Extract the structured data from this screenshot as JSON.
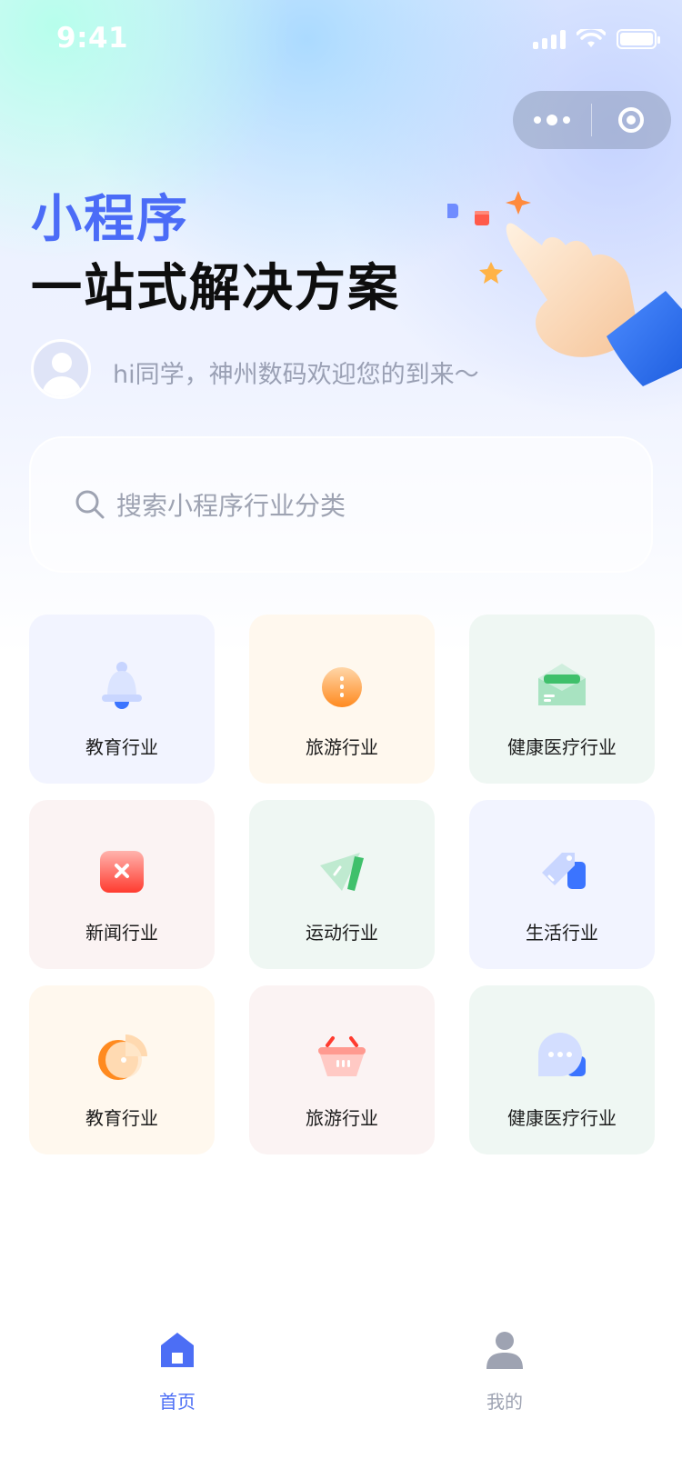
{
  "status_bar": {
    "time": "9:41"
  },
  "hero": {
    "title": "小程序",
    "subtitle": "一站式解决方案",
    "greeting": "hi同学，神州数码欢迎您的到来～"
  },
  "search": {
    "placeholder": "搜索小程序行业分类"
  },
  "categories": [
    {
      "label": "教育行业",
      "icon": "bell-icon",
      "bg": "#f2f4ff"
    },
    {
      "label": "旅游行业",
      "icon": "compass-icon",
      "bg": "#fff8ee"
    },
    {
      "label": "健康医疗行业",
      "icon": "envelope-icon",
      "bg": "#eff7f3"
    },
    {
      "label": "新闻行业",
      "icon": "close-box-icon",
      "bg": "#fbf3f3"
    },
    {
      "label": "运动行业",
      "icon": "paper-plane-icon",
      "bg": "#eff7f3"
    },
    {
      "label": "生活行业",
      "icon": "tag-icon",
      "bg": "#f2f4ff"
    },
    {
      "label": "教育行业",
      "icon": "pie-chart-icon",
      "bg": "#fff8ee"
    },
    {
      "label": "旅游行业",
      "icon": "basket-icon",
      "bg": "#fbf3f3"
    },
    {
      "label": "健康医疗行业",
      "icon": "chat-bubble-icon",
      "bg": "#eff7f3"
    }
  ],
  "tabbar": {
    "home": {
      "label": "首页",
      "icon": "home-icon",
      "active": true
    },
    "mine": {
      "label": "我的",
      "icon": "user-icon",
      "active": false
    }
  },
  "colors": {
    "accent": "#4c6ef5",
    "title_blue": "#4b6cf7",
    "muted": "#9ea3b2"
  }
}
